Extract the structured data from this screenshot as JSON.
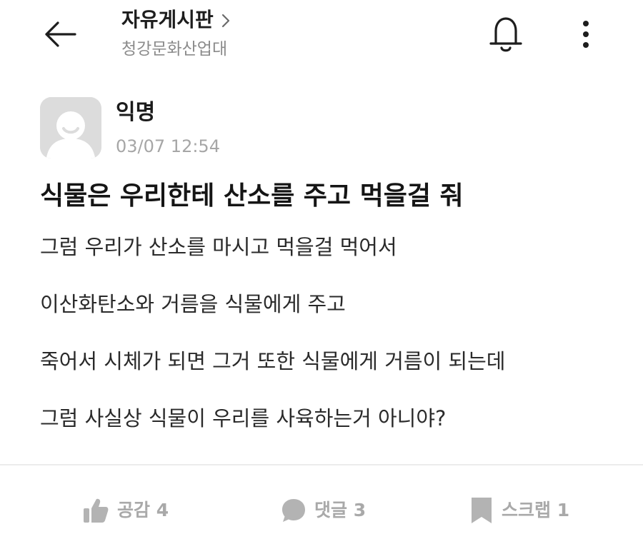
{
  "header": {
    "board_title": "자유게시판",
    "board_subtitle": "청강문화산업대",
    "icons": {
      "back": "arrow-left-icon",
      "chevron": "chevron-right-icon",
      "notification": "bell-icon",
      "more": "more-vertical-icon"
    }
  },
  "post": {
    "author": "익명",
    "datetime": "03/07 12:54",
    "title": "식물은 우리한테 산소를 주고 먹을걸 줘",
    "paragraphs": [
      "그럼 우리가 산소를 마시고 먹을걸 먹어서",
      "이산화탄소와 거름을 식물에게 주고",
      "죽어서 시체가 되면 그거 또한 식물에게 거름이 되는데",
      "그럼 사실상 식물이 우리를 사육하는거 아니야?"
    ]
  },
  "actions": {
    "like": {
      "label": "공감",
      "count": "4",
      "icon": "thumbs-up-icon"
    },
    "comment": {
      "label": "댓글",
      "count": "3",
      "icon": "speech-bubble-icon"
    },
    "scrap": {
      "label": "스크랩",
      "count": "1",
      "icon": "bookmark-icon"
    }
  },
  "colors": {
    "muted": "#a9a9a9",
    "subtitle": "#8b8b8b",
    "avatar_bg": "#dcdcdc",
    "text": "#222222"
  }
}
